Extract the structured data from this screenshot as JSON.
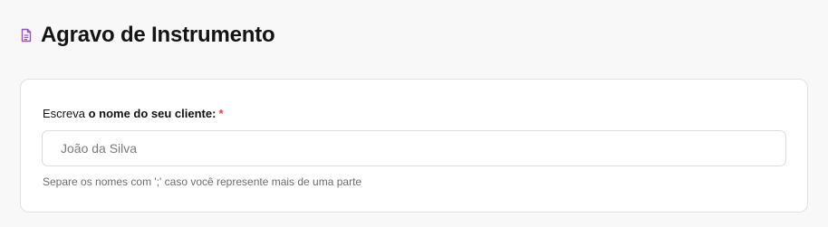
{
  "header": {
    "title": "Agravo de Instrumento",
    "icon": "document-icon",
    "icon_color": "#9b4dca"
  },
  "form": {
    "client_name": {
      "label_prefix": "Escreva ",
      "label_bold": "o nome do seu cliente:",
      "required_mark": "*",
      "placeholder": "João da Silva",
      "value": "",
      "helper_text": "Separe os nomes com ';' caso você represente mais de uma parte"
    }
  },
  "colors": {
    "required": "#e0433e",
    "page_background": "#f8f8f8",
    "card_background": "#ffffff"
  }
}
